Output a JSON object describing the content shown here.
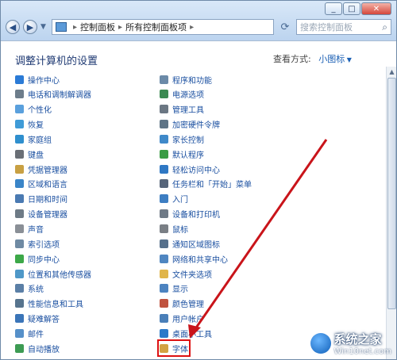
{
  "address": {
    "root_icon": "control-panel-icon",
    "crumbs": [
      "控制面板",
      "所有控制面板项"
    ]
  },
  "search": {
    "placeholder": "搜索控制面板"
  },
  "main": {
    "heading": "调整计算机的设置",
    "view_by_label": "查看方式:",
    "view_by_value": "小图标"
  },
  "items_left": [
    {
      "label": "操作中心",
      "icon": "flag-icon",
      "color": "#2b7bd6"
    },
    {
      "label": "电话和调制解调器",
      "icon": "phone-icon",
      "color": "#6d7d8b"
    },
    {
      "label": "个性化",
      "icon": "personalize-icon",
      "color": "#5aa0dd"
    },
    {
      "label": "恢复",
      "icon": "restore-icon",
      "color": "#3f9bd7"
    },
    {
      "label": "家庭组",
      "icon": "homegroup-icon",
      "color": "#2f8fce"
    },
    {
      "label": "键盘",
      "icon": "keyboard-icon",
      "color": "#6a6f76"
    },
    {
      "label": "凭据管理器",
      "icon": "credential-icon",
      "color": "#c8a043"
    },
    {
      "label": "区域和语言",
      "icon": "globe-icon",
      "color": "#3a85c8"
    },
    {
      "label": "日期和时间",
      "icon": "clock-icon",
      "color": "#4a7ab2"
    },
    {
      "label": "设备管理器",
      "icon": "device-manager-icon",
      "color": "#6e7b86"
    },
    {
      "label": "声音",
      "icon": "speaker-icon",
      "color": "#8a8f96"
    },
    {
      "label": "索引选项",
      "icon": "index-icon",
      "color": "#6f8aa3"
    },
    {
      "label": "同步中心",
      "icon": "sync-icon",
      "color": "#3ca848"
    },
    {
      "label": "位置和其他传感器",
      "icon": "location-icon",
      "color": "#4f98c8"
    },
    {
      "label": "系统",
      "icon": "system-icon",
      "color": "#5b7fa6"
    },
    {
      "label": "性能信息和工具",
      "icon": "performance-icon",
      "color": "#57748e"
    },
    {
      "label": "疑难解答",
      "icon": "troubleshoot-icon",
      "color": "#3b75b8"
    },
    {
      "label": "邮件",
      "icon": "mail-icon",
      "color": "#5690c9"
    },
    {
      "label": "自动播放",
      "icon": "autoplay-icon",
      "color": "#3d9b53"
    }
  ],
  "items_right": [
    {
      "label": "程序和功能",
      "icon": "programs-icon",
      "color": "#6b8aa8"
    },
    {
      "label": "电源选项",
      "icon": "power-icon",
      "color": "#3c8a52"
    },
    {
      "label": "管理工具",
      "icon": "admin-tools-icon",
      "color": "#6b7783"
    },
    {
      "label": "加密硬件令牌",
      "icon": "token-icon",
      "color": "#5e7486"
    },
    {
      "label": "家长控制",
      "icon": "parental-icon",
      "color": "#3f89c9"
    },
    {
      "label": "默认程序",
      "icon": "default-programs-icon",
      "color": "#3a9c45"
    },
    {
      "label": "轻松访问中心",
      "icon": "ease-access-icon",
      "color": "#2f78c4"
    },
    {
      "label": "任务栏和「开始」菜单",
      "icon": "taskbar-icon",
      "color": "#56657a"
    },
    {
      "label": "入门",
      "icon": "getting-started-icon",
      "color": "#3d7ec2"
    },
    {
      "label": "设备和打印机",
      "icon": "printer-icon",
      "color": "#6f7a86"
    },
    {
      "label": "鼠标",
      "icon": "mouse-icon",
      "color": "#7a7f85"
    },
    {
      "label": "通知区域图标",
      "icon": "notification-icon",
      "color": "#56708b"
    },
    {
      "label": "网络和共享中心",
      "icon": "network-icon",
      "color": "#4f86c1"
    },
    {
      "label": "文件夹选项",
      "icon": "folder-icon",
      "color": "#e0b54a"
    },
    {
      "label": "显示",
      "icon": "display-icon",
      "color": "#4c83c0"
    },
    {
      "label": "颜色管理",
      "icon": "color-icon",
      "color": "#c0533f"
    },
    {
      "label": "用户帐户",
      "icon": "user-icon",
      "color": "#4a7fb8"
    },
    {
      "label": "桌面小工具",
      "icon": "gadgets-icon",
      "color": "#2b7ac9"
    },
    {
      "label": "字体",
      "icon": "font-icon",
      "color": "#d3a243"
    }
  ],
  "watermark": {
    "title": "系统之家",
    "url": "Win10net.com"
  },
  "colors": {
    "highlight": "#d11111",
    "arrow": "#c9141a"
  }
}
